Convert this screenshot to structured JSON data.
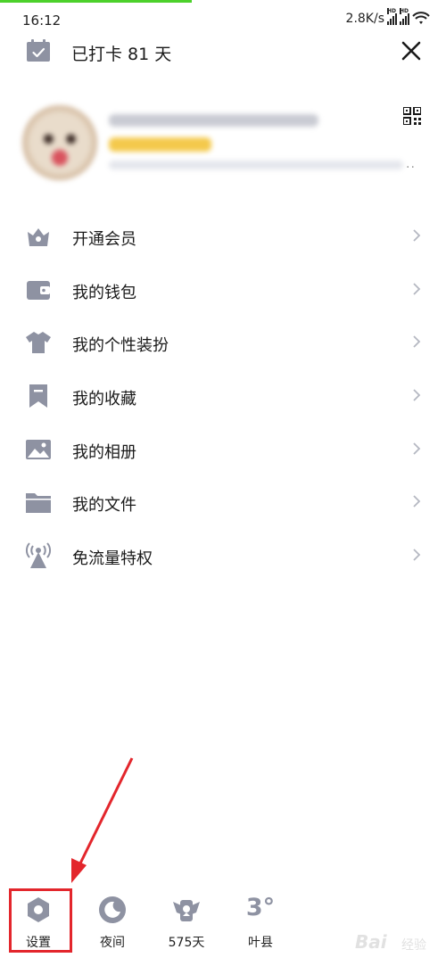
{
  "status_bar": {
    "time": "16:12",
    "speed": "2.8K/s",
    "signal_badge_1": "HD",
    "signal_badge_2": "HD"
  },
  "header": {
    "checkin_text": "已打卡 81 天",
    "checkin_icon": "calendar-check-icon",
    "close_icon": "close-icon"
  },
  "profile": {
    "qr_icon": "qr-code-icon",
    "more": ".."
  },
  "menu": {
    "items": [
      {
        "label": "开通会员",
        "icon": "crown-icon"
      },
      {
        "label": "我的钱包",
        "icon": "wallet-icon"
      },
      {
        "label": "我的个性装扮",
        "icon": "shirt-icon"
      },
      {
        "label": "我的收藏",
        "icon": "bookmark-icon"
      },
      {
        "label": "我的相册",
        "icon": "photo-icon"
      },
      {
        "label": "我的文件",
        "icon": "folder-icon"
      },
      {
        "label": "免流量特权",
        "icon": "antenna-icon"
      }
    ]
  },
  "bottom_bar": {
    "settings_label": "设置",
    "night_label": "夜间",
    "days_label": "575天",
    "weather_label": "叶县",
    "weather_temp": "3°"
  },
  "watermark": {
    "brand": "Bai",
    "sub": "经验"
  },
  "colors": {
    "icon_gray": "#8e92a2",
    "highlight_red": "#e3262c",
    "progress_green": "#4cd12b"
  }
}
